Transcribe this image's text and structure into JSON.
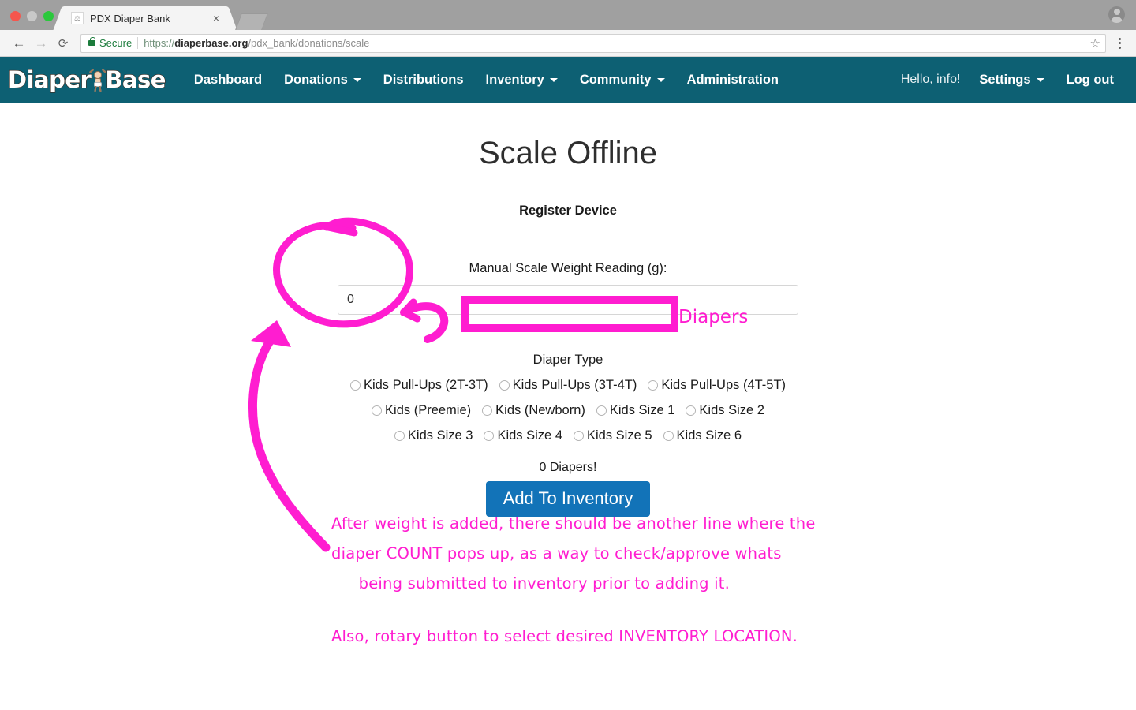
{
  "browser": {
    "tab": {
      "title": "PDX Diaper Bank",
      "favicon_icon": "diaper-favicon",
      "close_icon": "×"
    },
    "back_icon": "←",
    "forward_icon": "→",
    "reload_icon": "⟳",
    "security_label": "Secure",
    "lock_icon": "lock-icon",
    "url_scheme": "https://",
    "url_host": "diaperbase.org",
    "url_path": "/pdx_bank/donations/scale",
    "bookmark_icon": "☆",
    "menu_icon": "kebab-menu-icon",
    "profile_icon": "profile-avatar-icon",
    "new_tab_icon": "new-tab-icon"
  },
  "nav": {
    "brand": "DiaperBase",
    "brand_part1": "Diaper",
    "brand_part2": "Base",
    "items": [
      {
        "label": "Dashboard",
        "has_caret": false
      },
      {
        "label": "Donations",
        "has_caret": true
      },
      {
        "label": "Distributions",
        "has_caret": false
      },
      {
        "label": "Inventory",
        "has_caret": true
      },
      {
        "label": "Community",
        "has_caret": true
      },
      {
        "label": "Administration",
        "has_caret": false
      }
    ],
    "greeting": "Hello, info!",
    "settings": "Settings",
    "logout": "Log out",
    "bar_color": "#0d6073"
  },
  "main": {
    "title": "Scale Offline",
    "subtitle": "Register Device",
    "weight_label": "Manual Scale Weight Reading (g):",
    "weight_value": "0",
    "weight_placeholder": "",
    "diaper_type_label": "Diaper Type",
    "radio_rows": [
      [
        "Kids Pull-Ups (2T-3T)",
        "Kids Pull-Ups (3T-4T)",
        "Kids Pull-Ups (4T-5T)"
      ],
      [
        "Kids (Preemie)",
        "Kids (Newborn)",
        "Kids Size 1",
        "Kids Size 2"
      ],
      [
        "Kids Size 3",
        "Kids Size 4",
        "Kids Size 5",
        "Kids Size 6"
      ]
    ],
    "count_text": "0 Diapers!",
    "submit_label": "Add To Inventory",
    "submit_color": "#1273b8"
  },
  "annotations": {
    "color": "#ff1dd0",
    "diapers_label": "Diapers",
    "note_lines": [
      "After weight is added,  there should be another line where the",
      "diaper COUNT pops up, as a way to check/approve whats",
      "being submitted to inventory prior to adding it."
    ],
    "note2": "Also, rotary button to select desired INVENTORY LOCATION.",
    "marks": [
      "circle-around-weight-input",
      "rectangle-around-diaper-type",
      "hook-arrow",
      "curved-arrow-to-input"
    ]
  }
}
